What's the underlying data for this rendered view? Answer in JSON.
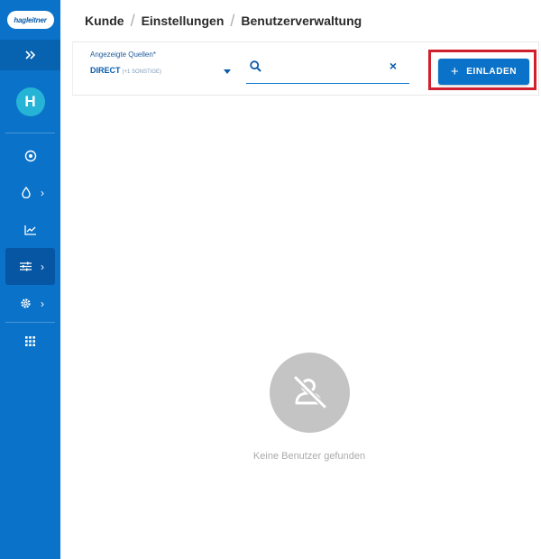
{
  "logo": {
    "text": "hagleitner"
  },
  "sidebar": {
    "expand_icon": "double-chevron-right-icon",
    "avatar_initial": "H",
    "items": [
      {
        "icon": "target-icon",
        "has_submenu": false
      },
      {
        "icon": "drop-icon",
        "has_submenu": true
      },
      {
        "icon": "line-chart-icon",
        "has_submenu": false
      },
      {
        "icon": "sliders-icon",
        "has_submenu": true,
        "active": true
      },
      {
        "icon": "gear-icon",
        "has_submenu": true
      },
      {
        "icon": "grid-icon",
        "has_submenu": false
      }
    ]
  },
  "breadcrumb": [
    "Kunde",
    "Einstellungen",
    "Benutzerverwaltung"
  ],
  "breadcrumb_separator": "/",
  "toolbar": {
    "sources_label": "Angezeigte Quellen*",
    "sources_value": "DIRECT",
    "sources_extra": "(+1 SONSTIGE)",
    "search_value": "",
    "search_placeholder": "",
    "clear_glyph": "×",
    "invite_plus": "+",
    "invite_label": "EINLADEN"
  },
  "empty_state": {
    "icon": "no-user-icon",
    "message": "Keine Benutzer gefunden"
  },
  "colors": {
    "sidebar": "#0a73c9",
    "sidebar_active": "#0656a3",
    "accent": "#0a5cab",
    "highlight": "#d0202e",
    "avatar": "#26b4d6"
  }
}
